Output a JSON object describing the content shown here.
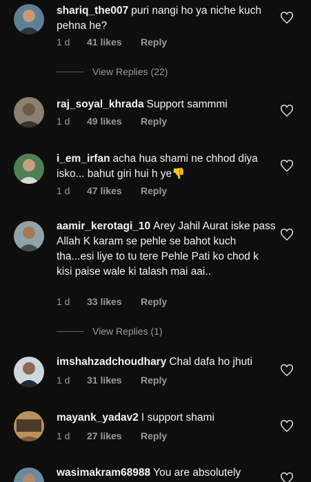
{
  "comments": [
    {
      "username": "shariq_the007",
      "text": "puri nangi ho ya niche kuch pehna he?",
      "time": "1 d",
      "likes": "41 likes",
      "reply": "Reply"
    },
    {
      "username": "raj_soyal_khrada",
      "text": "Support sammmi",
      "time": "1 d",
      "likes": "49 likes",
      "reply": "Reply"
    },
    {
      "username": "i_em_irfan",
      "text": "acha hua shami ne chhod diya isko... bahut giri hui h ye",
      "emoji": "👎",
      "time": "1 d",
      "likes": "47 likes",
      "reply": "Reply"
    },
    {
      "username": "aamir_kerotagi_10",
      "text": "Arey Jahil Aurat iske pass Allah K karam se pehle se bahot kuch tha...esi liye to tu tere Pehle Pati ko chod k kisi paise wale ki talash mai aai..",
      "time": "1 d",
      "likes": "33 likes",
      "reply": "Reply"
    },
    {
      "username": "imshahzadchoudhary",
      "text": "Chal dafa ho jhuti",
      "time": "1 d",
      "likes": "31 likes",
      "reply": "Reply"
    },
    {
      "username": "mayank_yadav2",
      "text": "I support shami",
      "time": "1 d",
      "likes": "27 likes",
      "reply": "Reply"
    },
    {
      "username": "wasimakram68988",
      "text": "You are absolutely"
    }
  ],
  "view_replies": [
    "View Replies (22)",
    "View Replies (1)"
  ],
  "colors": {
    "background": "#0e0e0e",
    "text": "#f2f2f2",
    "muted": "#9a9a9a"
  },
  "icons": {
    "like": "heart-outline-icon"
  }
}
